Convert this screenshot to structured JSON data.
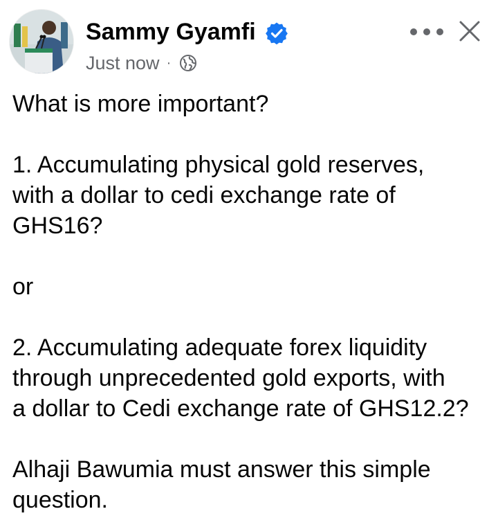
{
  "post": {
    "author": "Sammy Gyamfi",
    "time": "Just now",
    "separator": "·",
    "icons": {
      "verified": "verified-badge-icon",
      "audience": "globe-icon",
      "more": "more-options-icon",
      "close": "close-icon"
    },
    "colors": {
      "verified": "#1877f2",
      "meta": "#65676b",
      "text": "#050505"
    },
    "lines": [
      "What is more important?",
      "",
      "1. Accumulating physical gold reserves,",
      "with a dollar to cedi exchange rate of",
      "GHS16?",
      "",
      "or",
      "",
      "2. Accumulating adequate forex liquidity",
      "through unprecedented gold exports, with",
      "a dollar to Cedi exchange rate of GHS12.2?",
      "",
      "Alhaji Bawumia must answer this simple",
      "question."
    ]
  }
}
